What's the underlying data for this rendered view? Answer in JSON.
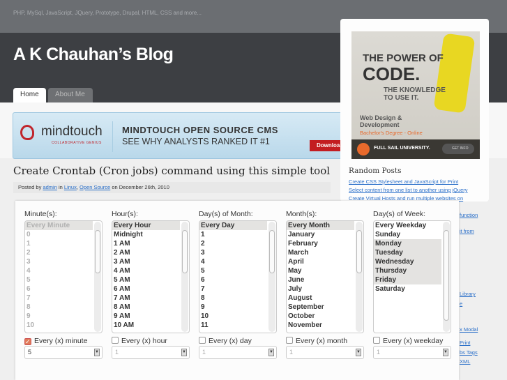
{
  "header": {
    "tagline": "PHP, MySql, JavaScript, JQuery, Prototype, Drupal, HTML, CSS and more...",
    "title": "A K Chauhan’s Blog",
    "tabs": [
      {
        "label": "Home",
        "active": true
      },
      {
        "label": "About Me",
        "active": false
      }
    ]
  },
  "banner": {
    "brand": "mindtouch",
    "tagline": "COLLABORATIVE GENIUS",
    "headline": "MINDTOUCH OPEN SOURCE CMS",
    "subline": "SEE WHY ANALYSTS RANKED IT #1",
    "button": "Downloa"
  },
  "post": {
    "title": "Create Crontab (Cron jobs) command using this simple tool",
    "posted_by": "Posted by",
    "author": "admin",
    "in": "in",
    "categories": [
      "Linux",
      "Open Source"
    ],
    "date": "on December 26th, 2010"
  },
  "sidebar": {
    "ad": {
      "line1": "THE POWER OF",
      "line2": "CODE.",
      "line3": "THE KNOWLEDGE",
      "line4": "TO USE IT.",
      "line5": "Web Design &",
      "line6": "Development",
      "line7": "Bachelor's Degree - Online",
      "school": "FULL SAIL UNIVERSITY.",
      "button": "GET INFO"
    },
    "random_posts_heading": "Random Posts",
    "random_posts": [
      "Create CSS Stylesheet and JavaScript for Print",
      "Select content from one list to another using jQuery",
      "Create Virtual Hosts and run multiple websites on"
    ],
    "fragments": [
      "function",
      "it from",
      "Library",
      "e",
      "x Modal",
      "Print",
      "bs Tags",
      "XML"
    ]
  },
  "cron": {
    "columns": [
      {
        "label": "Minute(s):",
        "options": [
          "Every Minute",
          "0",
          "1",
          "2",
          "3",
          "4",
          "5",
          "6",
          "7",
          "8",
          "9",
          "10"
        ],
        "selected": [
          0
        ],
        "disabled": true,
        "checkbox_label": "Every (x) minute",
        "checked": true,
        "select_value": "5"
      },
      {
        "label": "Hour(s):",
        "options": [
          "Every Hour",
          "Midnight",
          "1 AM",
          "2 AM",
          "3 AM",
          "4 AM",
          "5 AM",
          "6 AM",
          "7 AM",
          "8 AM",
          "9 AM",
          "10 AM"
        ],
        "selected": [
          0
        ],
        "disabled": false,
        "checkbox_label": "Every (x) hour",
        "checked": false,
        "select_value": "1"
      },
      {
        "label": "Day(s) of Month:",
        "options": [
          "Every Day",
          "1",
          "2",
          "3",
          "4",
          "5",
          "6",
          "7",
          "8",
          "9",
          "10",
          "11"
        ],
        "selected": [
          0
        ],
        "disabled": false,
        "checkbox_label": "Every (x) day",
        "checked": false,
        "select_value": "1"
      },
      {
        "label": "Month(s):",
        "options": [
          "Every Month",
          "January",
          "February",
          "March",
          "April",
          "May",
          "June",
          "July",
          "August",
          "September",
          "October",
          "November"
        ],
        "selected": [
          0
        ],
        "disabled": false,
        "checkbox_label": "Every (x) month",
        "checked": false,
        "select_value": "1"
      },
      {
        "label": "Day(s) of Week:",
        "options": [
          "Every Weekday",
          "Sunday",
          "Monday",
          "Tuesday",
          "Wednesday",
          "Thursday",
          "Friday",
          "Saturday"
        ],
        "selected": [
          2,
          3,
          4,
          5,
          6
        ],
        "disabled": false,
        "checkbox_label": "Every (x) weekday",
        "checked": false,
        "select_value": "1"
      }
    ]
  }
}
